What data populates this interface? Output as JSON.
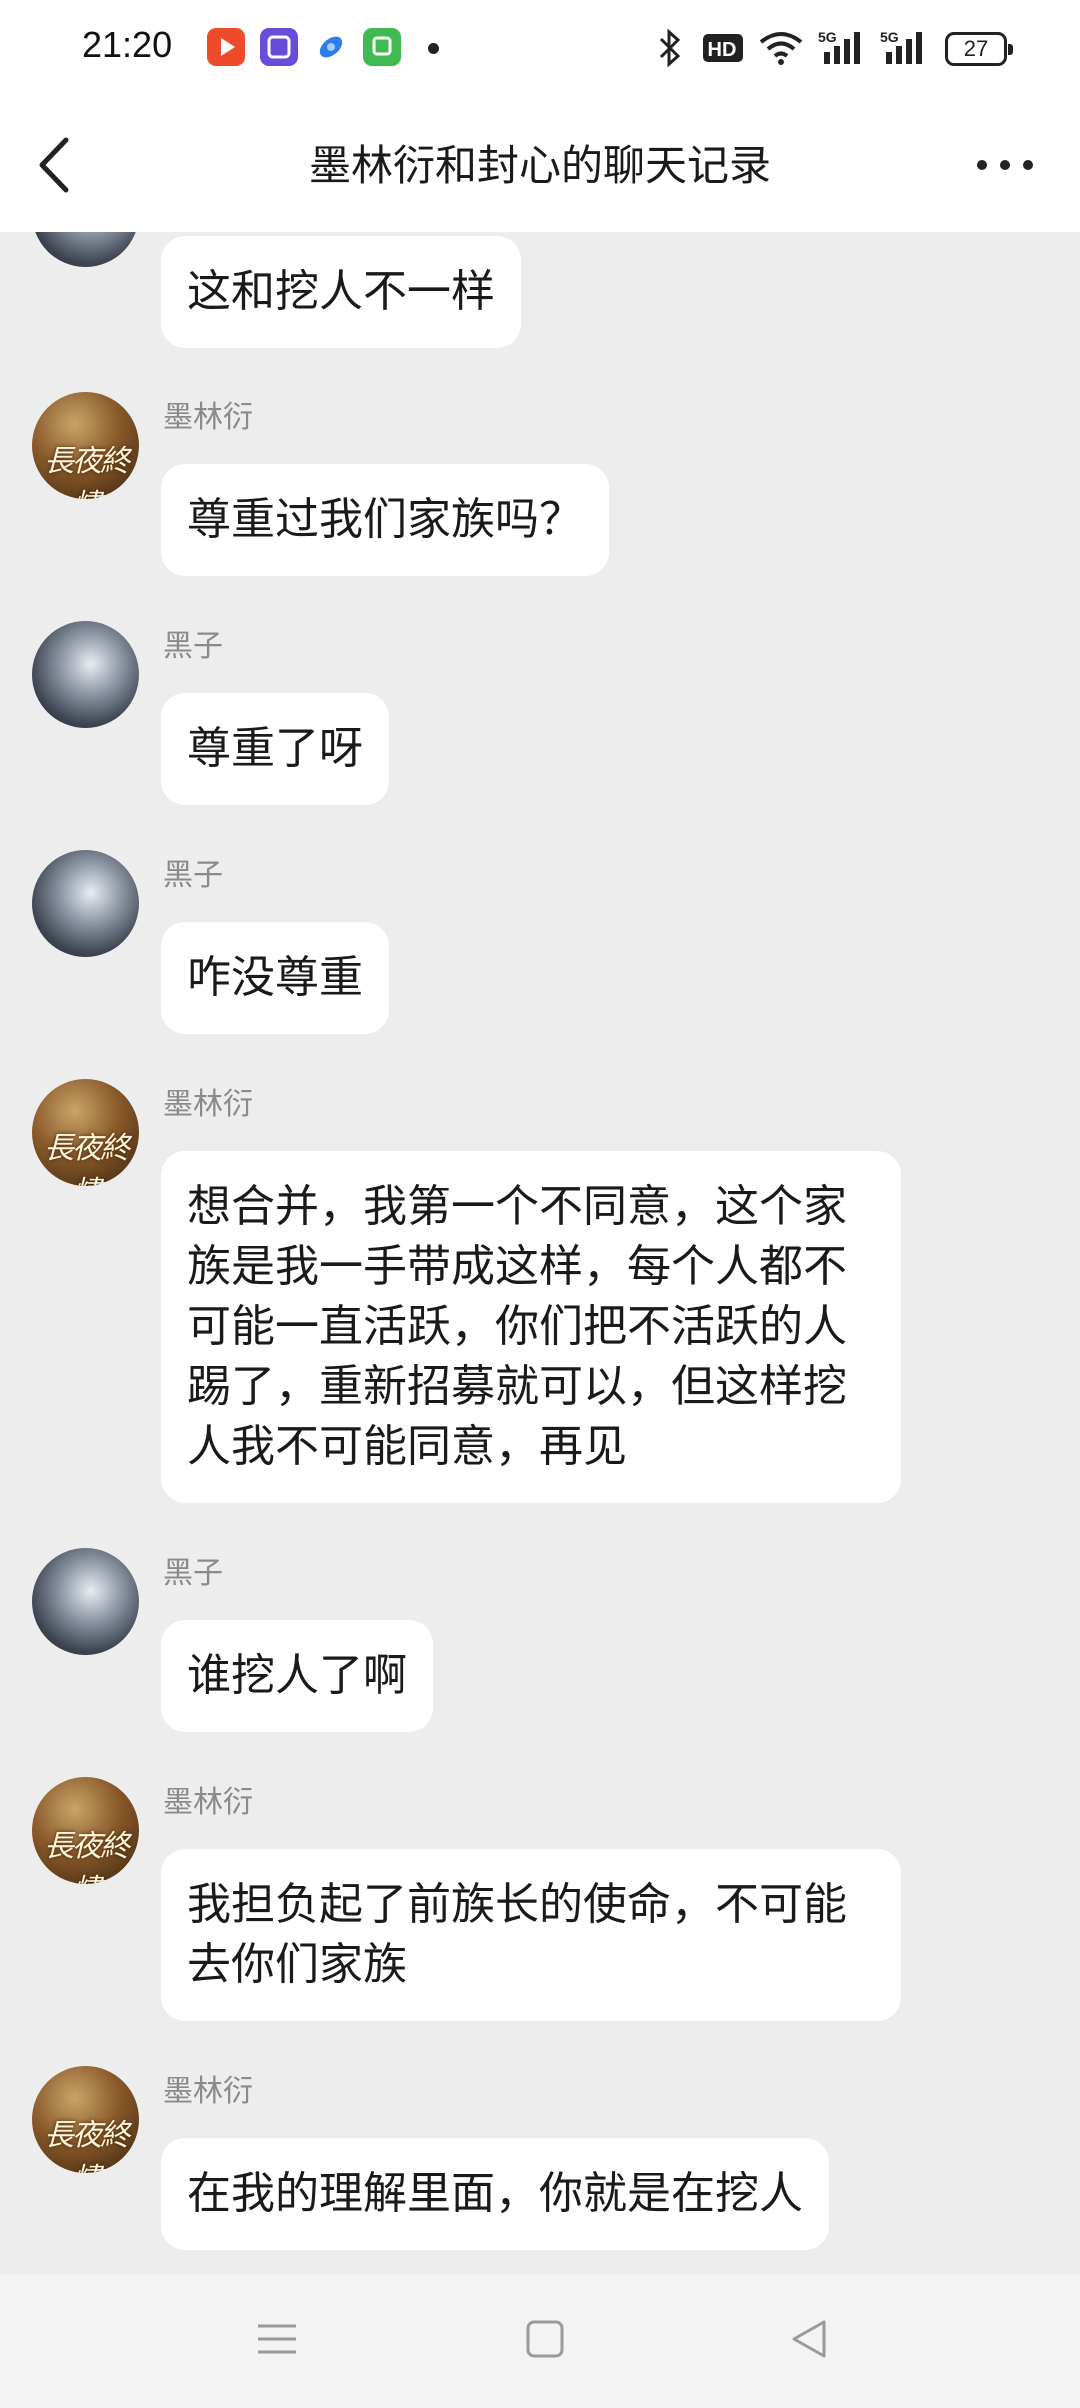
{
  "status_bar": {
    "time": "21:20",
    "battery": "27",
    "icons": [
      "video-app-icon",
      "tieba-app-icon",
      "browser-app-icon",
      "wallet-app-icon",
      "notification-dot",
      "bluetooth-icon",
      "hd-icon",
      "wifi-icon",
      "signal-5g-icon",
      "signal-5g-icon"
    ]
  },
  "nav": {
    "title": "墨林衍和封心的聊天记录",
    "back_icon": "chevron-left-icon",
    "more_icon": "more-horizontal-icon"
  },
  "messages": [
    {
      "sender": "",
      "avatar": "dark",
      "text": "这和挖人不一样"
    },
    {
      "sender": "墨林衍",
      "avatar": "gold",
      "text": "尊重过我们家族吗？"
    },
    {
      "sender": "黑子",
      "avatar": "dark",
      "text": "尊重了呀"
    },
    {
      "sender": "黑子",
      "avatar": "dark",
      "text": "咋没尊重"
    },
    {
      "sender": "墨林衍",
      "avatar": "gold",
      "text": "想合并，我第一个不同意，这个家\n族是我一手带成这样，每个人都不\n可能一直活跃，你们把不活跃的人\n踢了，重新招募就可以，但这样挖\n人我不可能同意，再见"
    },
    {
      "sender": "黑子",
      "avatar": "dark",
      "text": "谁挖人了啊"
    },
    {
      "sender": "墨林衍",
      "avatar": "gold",
      "text": "我担负起了前族长的使命，不可能\n去你们家族"
    },
    {
      "sender": "墨林衍",
      "avatar": "gold",
      "text": "在我的理解里面，你就是在挖人"
    }
  ],
  "avatar_art_text": "長夜終燼",
  "sys_nav": {
    "menu_icon": "menu-icon",
    "home_icon": "home-square-icon",
    "back_icon": "back-triangle-icon"
  }
}
